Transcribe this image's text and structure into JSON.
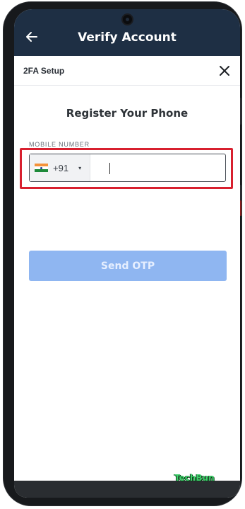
{
  "app_bar": {
    "title": "Verify Account",
    "back_icon": "arrow-left-icon",
    "background": "#1e2f44"
  },
  "sheet": {
    "title": "2FA Setup",
    "close_icon": "close-icon"
  },
  "form": {
    "heading": "Register Your Phone",
    "mobile_label": "MOBILE NUMBER",
    "country": {
      "flag_icon": "india-flag-icon",
      "dial_code": "+91",
      "caret": "▾"
    },
    "phone_value": "",
    "phone_placeholder": "",
    "highlight_color": "#d8202f"
  },
  "actions": {
    "send_otp_label": "Send OTP",
    "send_otp_color": "#8fb6f1"
  },
  "watermark": "TechBun"
}
